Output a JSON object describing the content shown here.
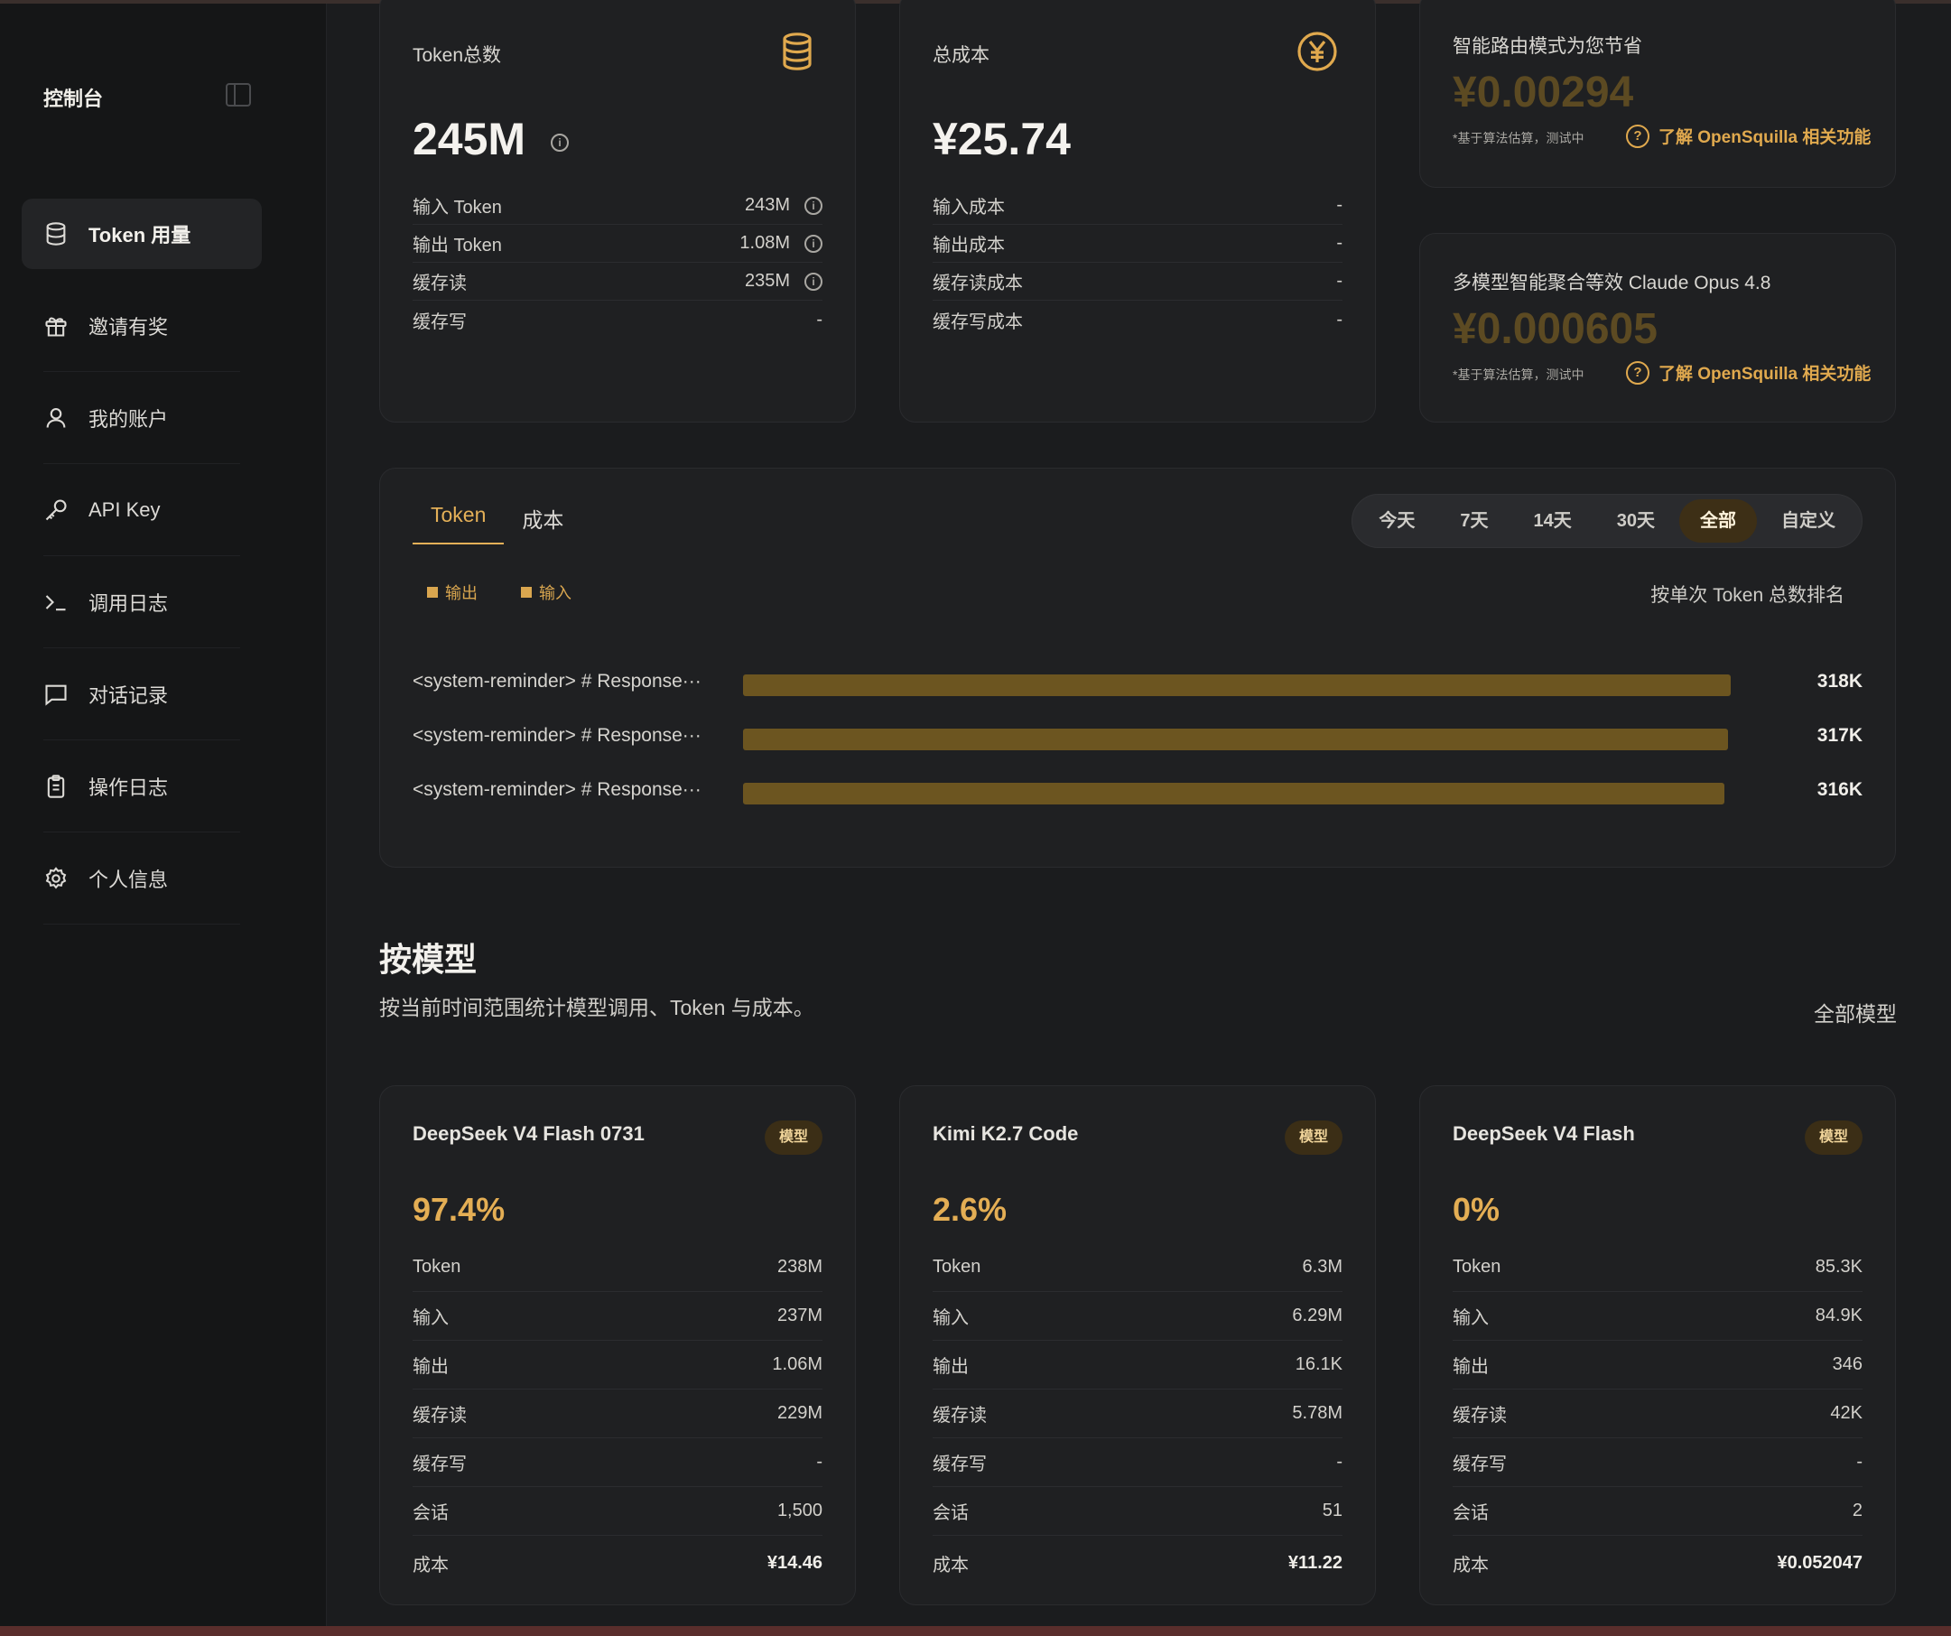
{
  "sidebar": {
    "brand": "控制台",
    "items": [
      {
        "label": "Token 用量",
        "active": true,
        "icon": "database-icon"
      },
      {
        "label": "邀请有奖",
        "icon": "gift-icon"
      },
      {
        "label": "我的账户",
        "icon": "user-icon"
      },
      {
        "label": "API Key",
        "icon": "key-icon"
      },
      {
        "label": "调用日志",
        "icon": "terminal-icon"
      },
      {
        "label": "对话记录",
        "icon": "chat-icon"
      },
      {
        "label": "操作日志",
        "icon": "clipboard-icon"
      },
      {
        "label": "个人信息",
        "icon": "gear-icon"
      }
    ]
  },
  "token_card": {
    "title": "Token总数",
    "total": "245M",
    "rows": [
      {
        "label": "输入 Token",
        "value": "243M"
      },
      {
        "label": "输出 Token",
        "value": "1.08M"
      },
      {
        "label": "缓存读",
        "value": "235M"
      },
      {
        "label": "缓存写",
        "value": "-"
      }
    ]
  },
  "cost_card": {
    "title": "总成本",
    "total": "¥25.74",
    "rows": [
      {
        "label": "输入成本",
        "value": "-"
      },
      {
        "label": "输出成本",
        "value": "-"
      },
      {
        "label": "缓存读成本",
        "value": "-"
      },
      {
        "label": "缓存写成本",
        "value": "-"
      }
    ]
  },
  "savings": [
    {
      "title": "智能路由模式为您节省",
      "amount": "¥0.00294",
      "note": "*基于算法估算，测试中",
      "link": "了解 OpenSquilla 相关功能"
    },
    {
      "title": "多模型智能聚合等效 Claude Opus 4.8",
      "amount": "¥0.000605",
      "note": "*基于算法估算，测试中",
      "link": "了解 OpenSquilla 相关功能"
    }
  ],
  "usage_chart": {
    "tabs": [
      "Token",
      "成本"
    ],
    "active_tab": 0,
    "ranges": [
      "今天",
      "7天",
      "14天",
      "30天",
      "全部",
      "自定义"
    ],
    "active_range": 4,
    "legend": [
      "输出",
      "输入"
    ],
    "rank_label": "按单次 Token 总数排名",
    "accent": "#d9a64f"
  },
  "chart_data": {
    "type": "bar",
    "orientation": "horizontal",
    "categories": [
      "<system-reminder> # Response···",
      "<system-reminder> # Response···",
      "<system-reminder> # Response···"
    ],
    "value_labels": [
      "318K",
      "317K",
      "316K"
    ],
    "values": [
      318,
      317,
      316
    ],
    "unit": "K",
    "xlim": [
      0,
      318
    ]
  },
  "models_section": {
    "title": "按模型",
    "subtitle": "按当前时间范围统计模型调用、Token 与成本。",
    "filter": "全部模型",
    "cards": [
      {
        "name": "DeepSeek V4 Flash 0731",
        "badge": "模型",
        "pct": "97.4%",
        "rows": [
          [
            "Token",
            "238M"
          ],
          [
            "输入",
            "237M"
          ],
          [
            "输出",
            "1.06M"
          ],
          [
            "缓存读",
            "229M"
          ],
          [
            "缓存写",
            "-"
          ],
          [
            "会话",
            "1,500"
          ]
        ],
        "cost_label": "成本",
        "cost": "¥14.46"
      },
      {
        "name": "Kimi K2.7 Code",
        "badge": "模型",
        "pct": "2.6%",
        "rows": [
          [
            "Token",
            "6.3M"
          ],
          [
            "输入",
            "6.29M"
          ],
          [
            "输出",
            "16.1K"
          ],
          [
            "缓存读",
            "5.78M"
          ],
          [
            "缓存写",
            "-"
          ],
          [
            "会话",
            "51"
          ]
        ],
        "cost_label": "成本",
        "cost": "¥11.22"
      },
      {
        "name": "DeepSeek V4 Flash",
        "badge": "模型",
        "pct": "0%",
        "rows": [
          [
            "Token",
            "85.3K"
          ],
          [
            "输入",
            "84.9K"
          ],
          [
            "输出",
            "346"
          ],
          [
            "缓存读",
            "42K"
          ],
          [
            "缓存写",
            "-"
          ],
          [
            "会话",
            "2"
          ]
        ],
        "cost_label": "成本",
        "cost": "¥0.052047"
      }
    ]
  }
}
